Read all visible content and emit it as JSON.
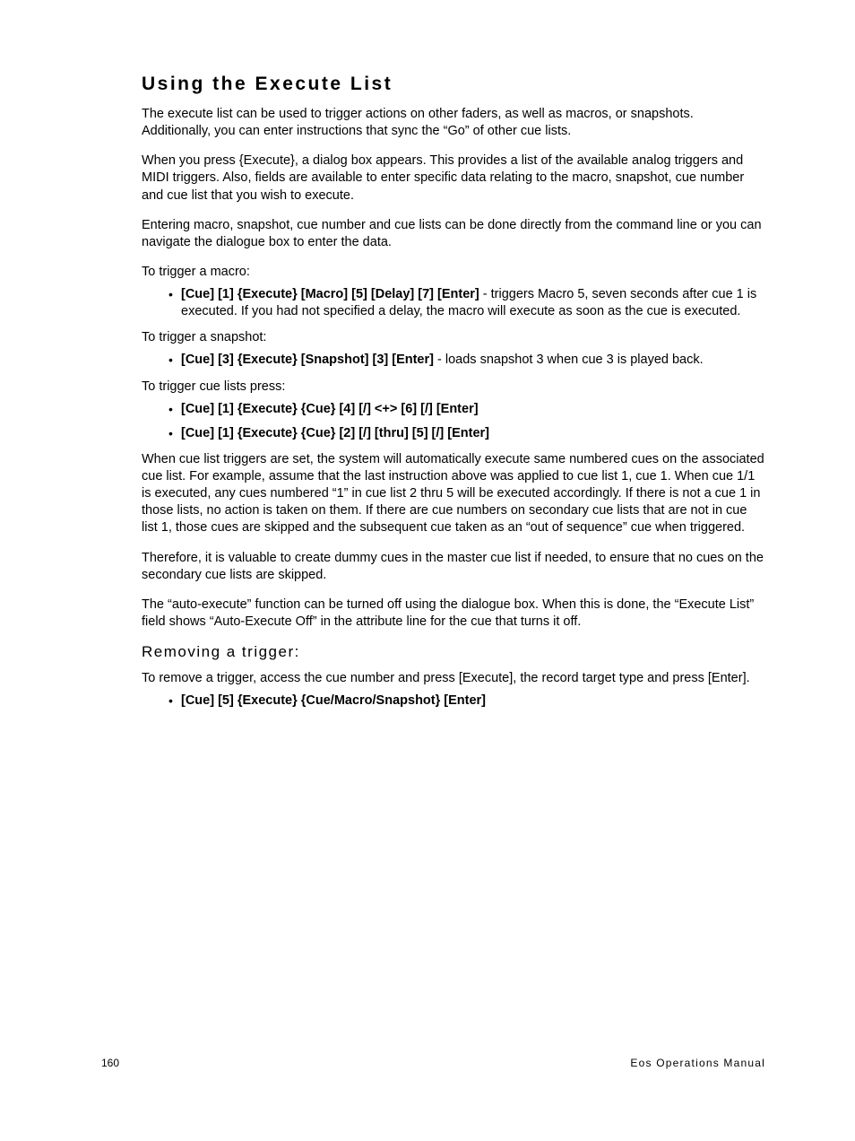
{
  "section": {
    "title": "Using the Execute List",
    "para1": "The execute list can be used to trigger actions on other faders, as well as macros, or snapshots. Additionally, you can enter instructions that sync the “Go” of other cue lists.",
    "para2": "When you press {Execute}, a dialog box appears. This provides a list of the available analog triggers and MIDI triggers. Also, fields are available to enter specific data relating to the macro, snapshot, cue number and cue list that you wish to execute.",
    "para3": "Entering macro, snapshot, cue number and cue lists can be done directly from the command line or you can navigate the dialogue box to enter the data.",
    "para4": "To trigger a macro:",
    "bullet1_bold": "[Cue] [1] {Execute} [Macro] [5] [Delay] [7] [Enter]",
    "bullet1_rest": " - triggers Macro 5, seven seconds after cue 1 is executed. If you had not specified a delay, the macro will execute as soon as the cue is executed.",
    "para5": "To trigger a snapshot:",
    "bullet2_bold": "[Cue] [3] {Execute} [Snapshot] [3] [Enter]",
    "bullet2_rest": " - loads snapshot 3 when cue 3 is played back.",
    "para6": "To trigger cue lists press:",
    "bullet3_bold": "[Cue] [1] {Execute} {Cue} [4] [/] <+> [6] [/] [Enter]",
    "bullet4_bold": "[Cue] [1] {Execute} {Cue} [2] [/] [thru] [5] [/] [Enter]",
    "para7": "When cue list triggers are set, the system will automatically execute same numbered cues on the associated cue list. For example, assume that the last instruction above was applied to cue list 1, cue 1. When cue 1/1 is executed, any cues numbered “1” in cue list 2 thru 5 will be executed accordingly. If there is not a cue 1 in those lists, no action is taken on them. If there are cue numbers on secondary cue lists that are not in cue list 1, those cues are skipped and the subsequent cue taken as an “out of sequence” cue when triggered.",
    "para8": "Therefore, it is valuable to create dummy cues in the master cue list if needed, to ensure that no cues on the secondary cue lists are skipped.",
    "para9": "The “auto-execute” function can be turned off using the dialogue box. When this is done, the “Execute List” field shows “Auto-Execute Off” in the attribute line for the cue that turns it off."
  },
  "subsection": {
    "title": "Removing a trigger:",
    "para1": "To remove a trigger, access the cue number and press [Execute], the record target type and press [Enter].",
    "bullet1_bold": "[Cue] [5] {Execute} {Cue/Macro/Snapshot} [Enter]"
  },
  "footer": {
    "page_num": "160",
    "manual_name": "Eos Operations Manual"
  }
}
